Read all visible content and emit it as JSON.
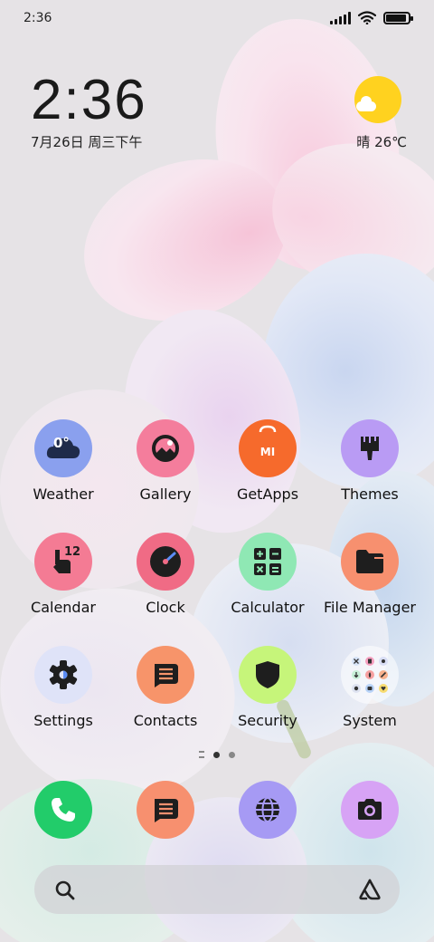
{
  "status_bar": {
    "time": "2:36",
    "battery_level": 0.9
  },
  "clock_widget": {
    "time": "2:36",
    "date": "7月26日 周三下午"
  },
  "weather_widget": {
    "condition": "晴",
    "temperature": "26℃",
    "icon": "sun-cloud-icon"
  },
  "apps": [
    {
      "label": "Weather",
      "icon": "weather-icon",
      "bg": "#8aa0ee"
    },
    {
      "label": "Gallery",
      "icon": "gallery-icon",
      "bg": "#f47d9c"
    },
    {
      "label": "GetApps",
      "icon": "getapps-icon",
      "bg": "#f66a2c"
    },
    {
      "label": "Themes",
      "icon": "themes-icon",
      "bg": "#b99bf4"
    },
    {
      "label": "Calendar",
      "icon": "calendar-icon",
      "bg": "#f47b94"
    },
    {
      "label": "Clock",
      "icon": "clock-icon",
      "bg": "#f06b85"
    },
    {
      "label": "Calculator",
      "icon": "calculator-icon",
      "bg": "#8fe8b4"
    },
    {
      "label": "File Manager",
      "icon": "folder-icon",
      "bg": "#f7906f"
    },
    {
      "label": "Settings",
      "icon": "gear-icon",
      "bg": "#dfe3f8"
    },
    {
      "label": "Contacts",
      "icon": "contacts-icon",
      "bg": "#f7946a"
    },
    {
      "label": "Security",
      "icon": "shield-icon",
      "bg": "#c6f57a"
    },
    {
      "label": "System",
      "icon": "folder-grid-icon",
      "bg": "rgba(255,255,255,0.55)"
    }
  ],
  "weather_icon_text": "0°",
  "getapps_icon_text": "MI",
  "calendar_icon_text": "12",
  "page_indicator": {
    "pages": 2,
    "active": 1
  },
  "dock": [
    {
      "name": "phone",
      "icon": "phone-icon",
      "bg": "#22cc6a"
    },
    {
      "name": "messages",
      "icon": "messages-icon",
      "bg": "#f7906f"
    },
    {
      "name": "browser",
      "icon": "globe-icon",
      "bg": "#a69af4"
    },
    {
      "name": "camera",
      "icon": "camera-icon",
      "bg": "#d7a3f5"
    }
  ]
}
